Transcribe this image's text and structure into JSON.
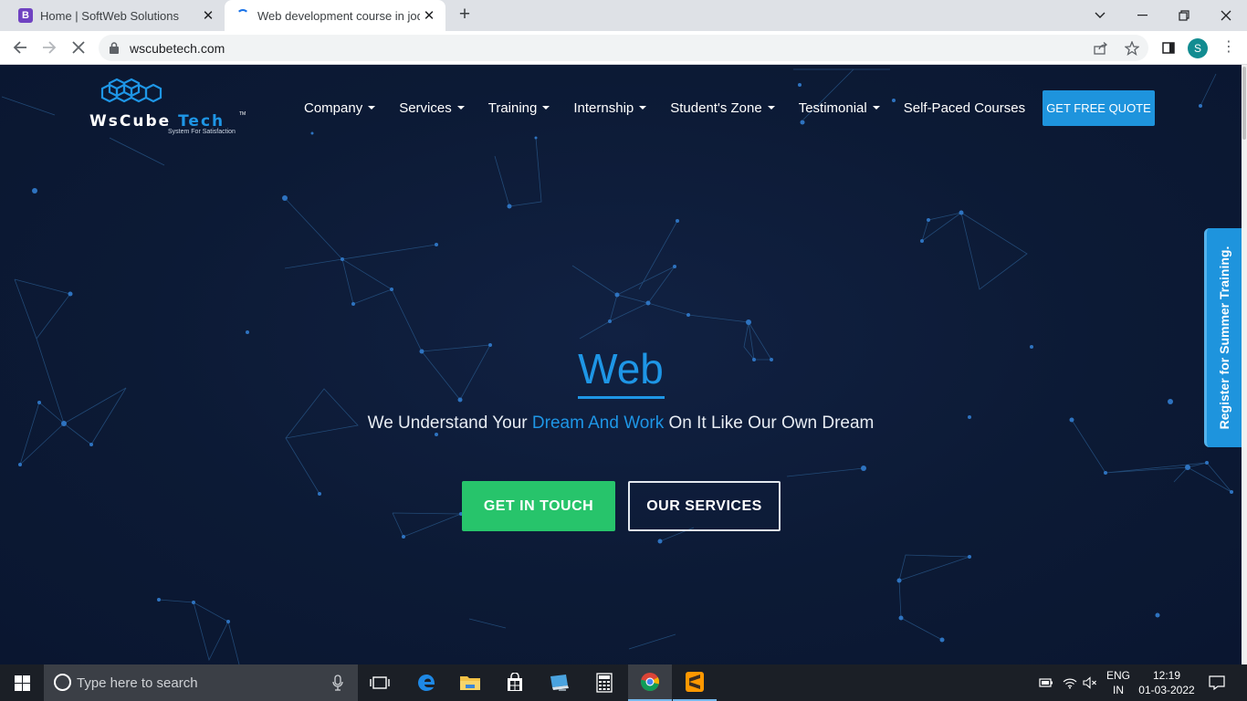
{
  "browser": {
    "tabs": [
      {
        "title": "Home | SoftWeb Solutions",
        "favicon": "B",
        "active": false
      },
      {
        "title": "Web development course in jodh",
        "active": true
      }
    ],
    "url": "wscubetech.com",
    "profile_initial": "S"
  },
  "page": {
    "logo": {
      "word1": "WsCube",
      "word2": "Tech",
      "tm": "TM",
      "tagline": "System For Satisfaction"
    },
    "nav": [
      {
        "label": "Company",
        "dropdown": true
      },
      {
        "label": "Services",
        "dropdown": true
      },
      {
        "label": "Training",
        "dropdown": true
      },
      {
        "label": "Internship",
        "dropdown": true
      },
      {
        "label": "Student's Zone",
        "dropdown": true
      },
      {
        "label": "Testimonial",
        "dropdown": true
      },
      {
        "label": "Self-Paced Courses",
        "dropdown": false
      }
    ],
    "quote_button": "GET FREE QUOTE",
    "hero": {
      "word": "Web",
      "tagline_pre": "We Understand Your ",
      "tagline_highlight": "Dream And Work",
      "tagline_post": " On It Like Our Own Dream"
    },
    "buttons": {
      "touch": "GET IN TOUCH",
      "services": "OUR SERVICES"
    },
    "side_tab": "Register for Summer Training."
  },
  "taskbar": {
    "search_placeholder": "Type here to search",
    "lang_line1": "ENG",
    "lang_line2": "IN",
    "time": "12:19",
    "date": "01-03-2022"
  },
  "colors": {
    "accent": "#1e96e6",
    "green_button": "#27c46b",
    "background": "#0c1a33"
  }
}
